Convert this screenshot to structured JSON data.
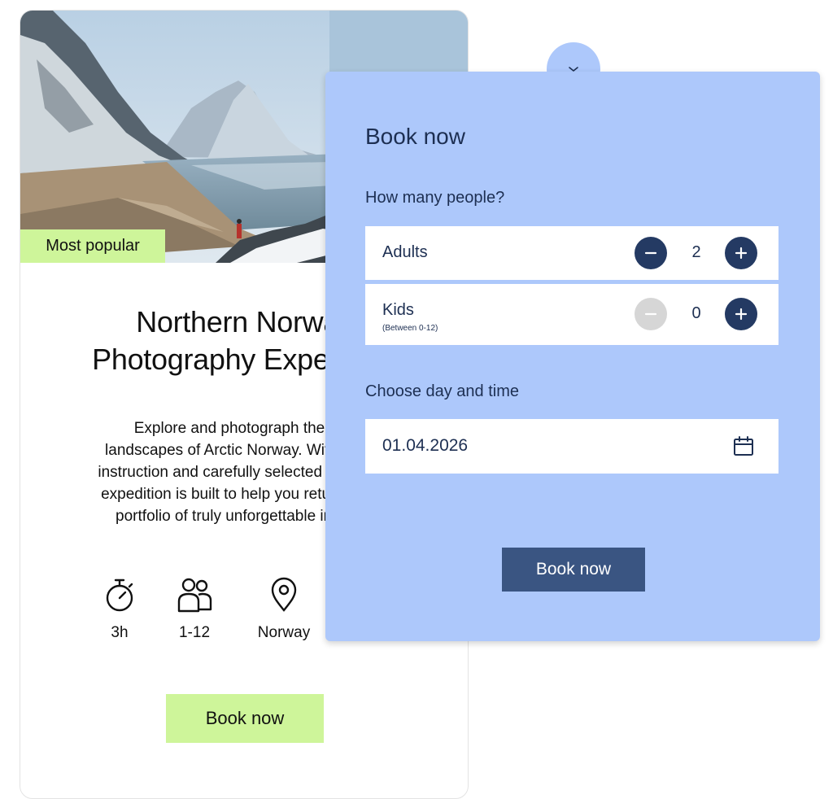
{
  "card": {
    "badge": "Most popular",
    "title_lines": [
      "Northern Norway",
      "Photography Expedition"
    ],
    "description_lines": [
      "Explore and photograph the wild",
      "landscapes of Arctic Norway. With expert",
      "instruction and carefully selected locations,",
      "expedition is built to help you return with a",
      "portfolio of truly unforgettable images."
    ],
    "features": [
      {
        "icon": "stopwatch-icon",
        "label": "3h"
      },
      {
        "icon": "people-icon",
        "label": "1-12"
      },
      {
        "icon": "location-pin-icon",
        "label": "Norway"
      }
    ],
    "book_label": "Book now"
  },
  "booking": {
    "toggle_icon": "chevron-down-icon",
    "title": "Book now",
    "people_label": "How many people?",
    "adults": {
      "label": "Adults",
      "count": "2"
    },
    "kids": {
      "label": "Kids",
      "sublabel": "(Between 0-12)",
      "count": "0"
    },
    "date_label": "Choose day and time",
    "date_value": "01.04.2026",
    "date_icon": "calendar-icon",
    "book_label": "Book now"
  },
  "colors": {
    "panel_bg": "#adc8fb",
    "accent_green": "#cef59a",
    "navy": "#243a63",
    "button_blue": "#3a5582",
    "disabled_gray": "#d6d6d6"
  }
}
